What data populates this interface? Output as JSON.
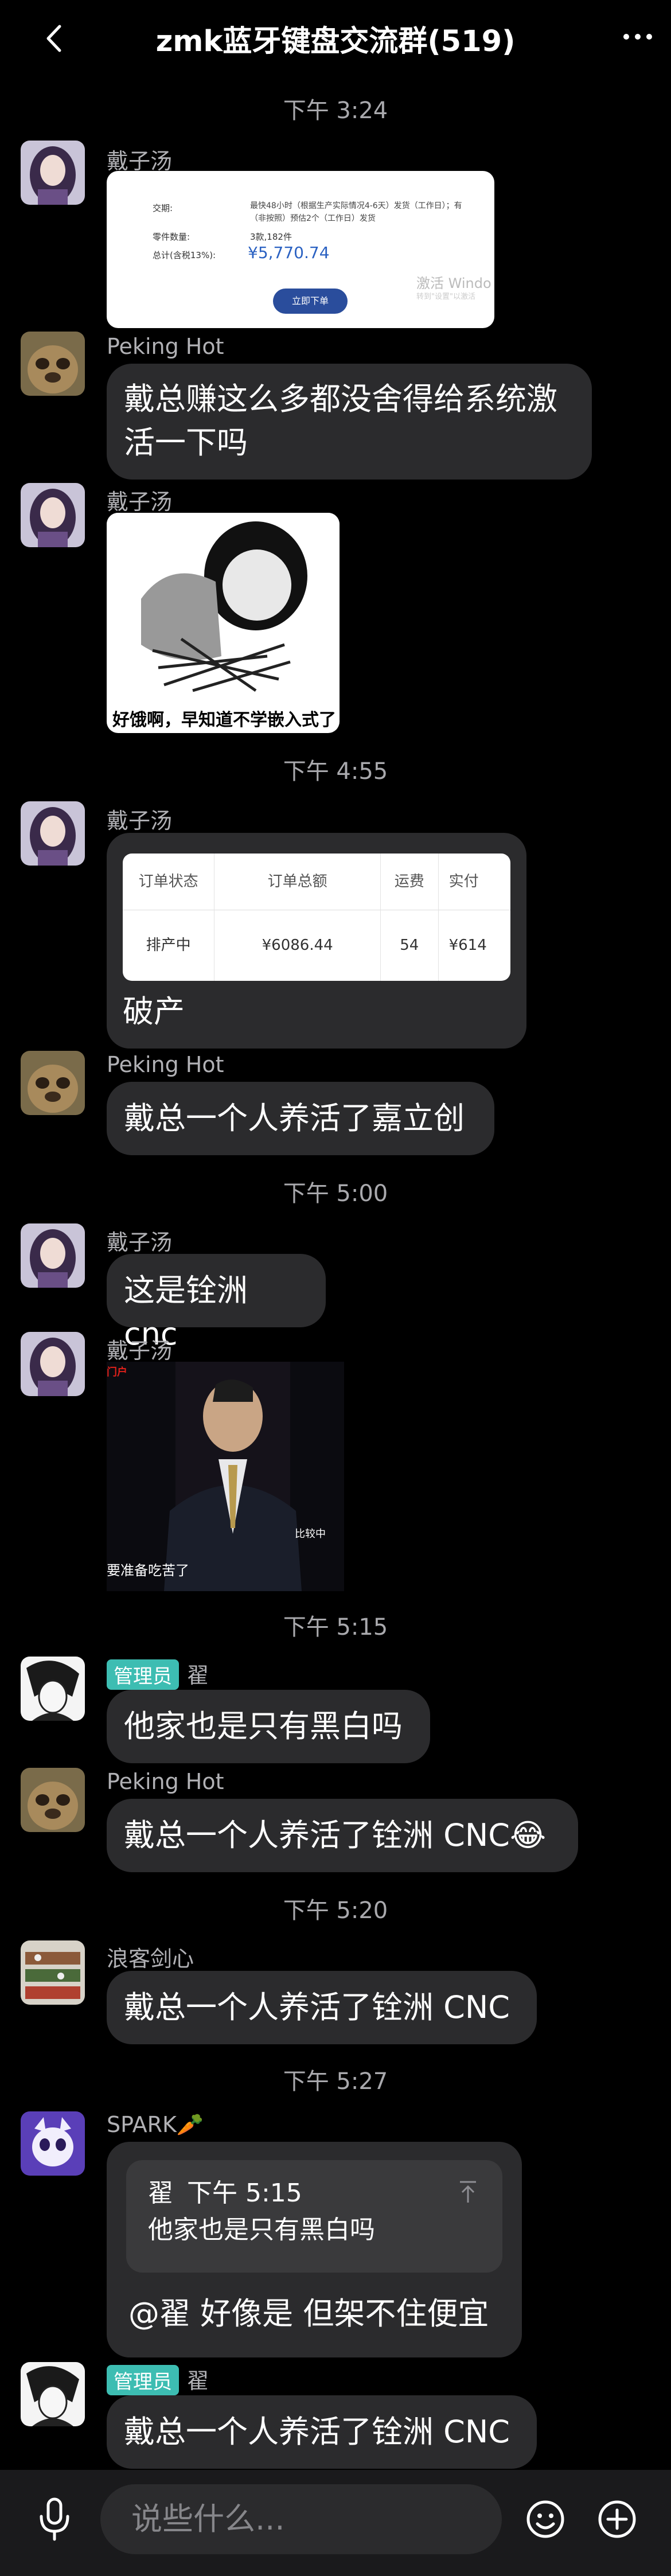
{
  "header": {
    "title": "zmk蓝牙键盘交流群(519)"
  },
  "timestamps": [
    "下午 3:24",
    "下午 4:55",
    "下午 5:00",
    "下午 5:15",
    "下午 5:20",
    "下午 5:27"
  ],
  "users": {
    "daizitang": "戴子汤",
    "peking": "Peking Hot",
    "zhai": "翟",
    "langke": "浪客剑心",
    "spark": "SPARK🥕",
    "admin_badge": "管理员"
  },
  "messages": {
    "order_screenshot": {
      "row1_label": "交期:",
      "row1_value": "最快48小时（根据生产实际情况4-6天）发货（工作日）；有（非按照）预估2个（工作日）发货",
      "row2_label": "零件数量:",
      "row2_value": "3款,182件",
      "row3_label": "总计(含税13%):",
      "price": "¥5,770.74",
      "order_button": "立即下单",
      "watermark": "激活 Windo",
      "watermark2": "转到\"设置\"以激活"
    },
    "m1": "戴总赚这么多都没舍得给系统激活一下吗",
    "meme_caption": "好饿啊，早知道不学嵌入式了",
    "order_table": {
      "headers": [
        "订单状态",
        "订单总额",
        "运费",
        "实付"
      ],
      "row": [
        "排产中",
        "¥6086.44",
        "54",
        "¥614"
      ]
    },
    "m2": "破产",
    "m3": "戴总一个人养活了嘉立创",
    "m4": "这是铨洲 cnc",
    "video_caption": "要准备吃苦了",
    "video_tag": "比较中",
    "video_logo": "门户",
    "m5": "他家也是只有黑白吗",
    "m6": "戴总一个人养活了铨洲 CNC😂",
    "m7": "戴总一个人养活了铨洲 CNC",
    "quote": {
      "author": "翟",
      "time": "下午 5:15",
      "text": "他家也是只有黑白吗"
    },
    "m8": "@翟 好像是 但架不住便宜",
    "m9": "戴总一个人养活了铨洲 CNC"
  },
  "input": {
    "placeholder": "说些什么..."
  },
  "colors": {
    "bubble": "#2b2b2d",
    "badge": "#3dbdb2",
    "background": "#000000"
  }
}
